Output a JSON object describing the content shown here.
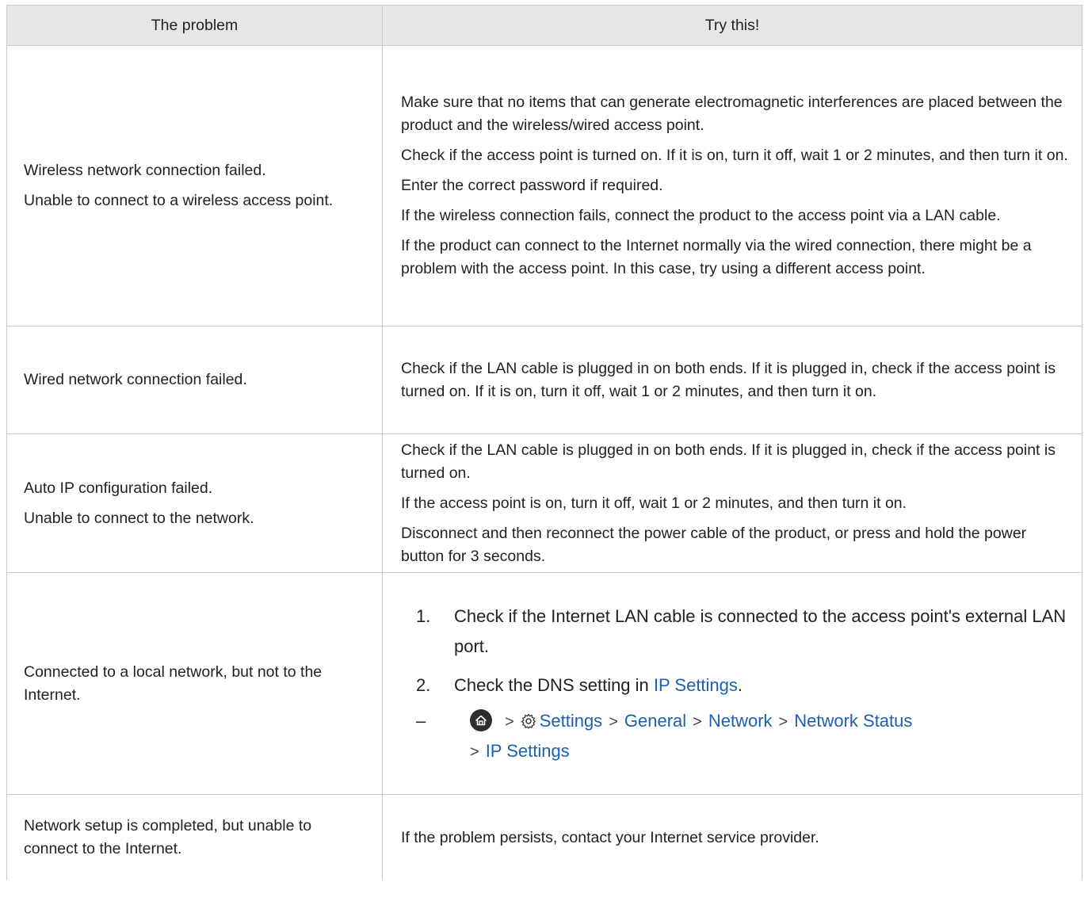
{
  "header": {
    "problem_label": "The problem",
    "try_label": "Try this!"
  },
  "rows": [
    {
      "problem": [
        "Wireless network connection failed.",
        "Unable to connect to a wireless access point."
      ],
      "solutions": [
        "Make sure that no items that can generate electromagnetic interferences are placed between the product and the wireless/wired access point.",
        "Check if the access point is turned on. If it is on, turn it off, wait 1 or 2 minutes, and then turn it on.",
        "Enter the correct password if required.",
        "If the wireless connection fails, connect the product to the access point via a LAN cable.",
        "If the product can connect to the Internet normally via the wired connection, there might be a problem with the access point. In this case, try using a different access point."
      ]
    },
    {
      "problem": [
        "Wired network connection failed."
      ],
      "solutions": [
        "Check if the LAN cable is plugged in on both ends. If it is plugged in, check if the access point is turned on. If it is on, turn it off, wait 1 or 2 minutes, and then turn it on."
      ]
    },
    {
      "problem": [
        "Auto IP configuration failed.",
        "Unable to connect to the network."
      ],
      "solutions": [
        "Check if the LAN cable is plugged in on both ends. If it is plugged in, check if the access point is turned on.",
        "If the access point is on, turn it off, wait 1 or 2 minutes, and then turn it on.",
        "Disconnect and then reconnect the power cable of the product, or press and hold the power button for 3 seconds."
      ]
    },
    {
      "problem": [
        "Connected to a local network, but not to the Internet."
      ],
      "steps": [
        {
          "marker": "1.",
          "text": "Check if the Internet LAN cable is connected to the access point's external LAN port."
        },
        {
          "marker": "2.",
          "text": "Check the DNS setting in ",
          "link": "IP Settings",
          "suffix": "."
        }
      ],
      "path": {
        "dash": "–",
        "items": [
          "Settings",
          "General",
          "Network",
          "Network Status",
          "IP Settings"
        ],
        "separator": ">"
      }
    },
    {
      "problem": [
        "Network setup is completed, but unable to connect to the Internet."
      ],
      "solutions": [
        "If the problem persists, contact your Internet service provider."
      ]
    }
  ],
  "colors": {
    "header_bg": "#e6e6e6",
    "border": "#c9c9c9",
    "link": "#1c5fb3",
    "text": "#222222"
  }
}
